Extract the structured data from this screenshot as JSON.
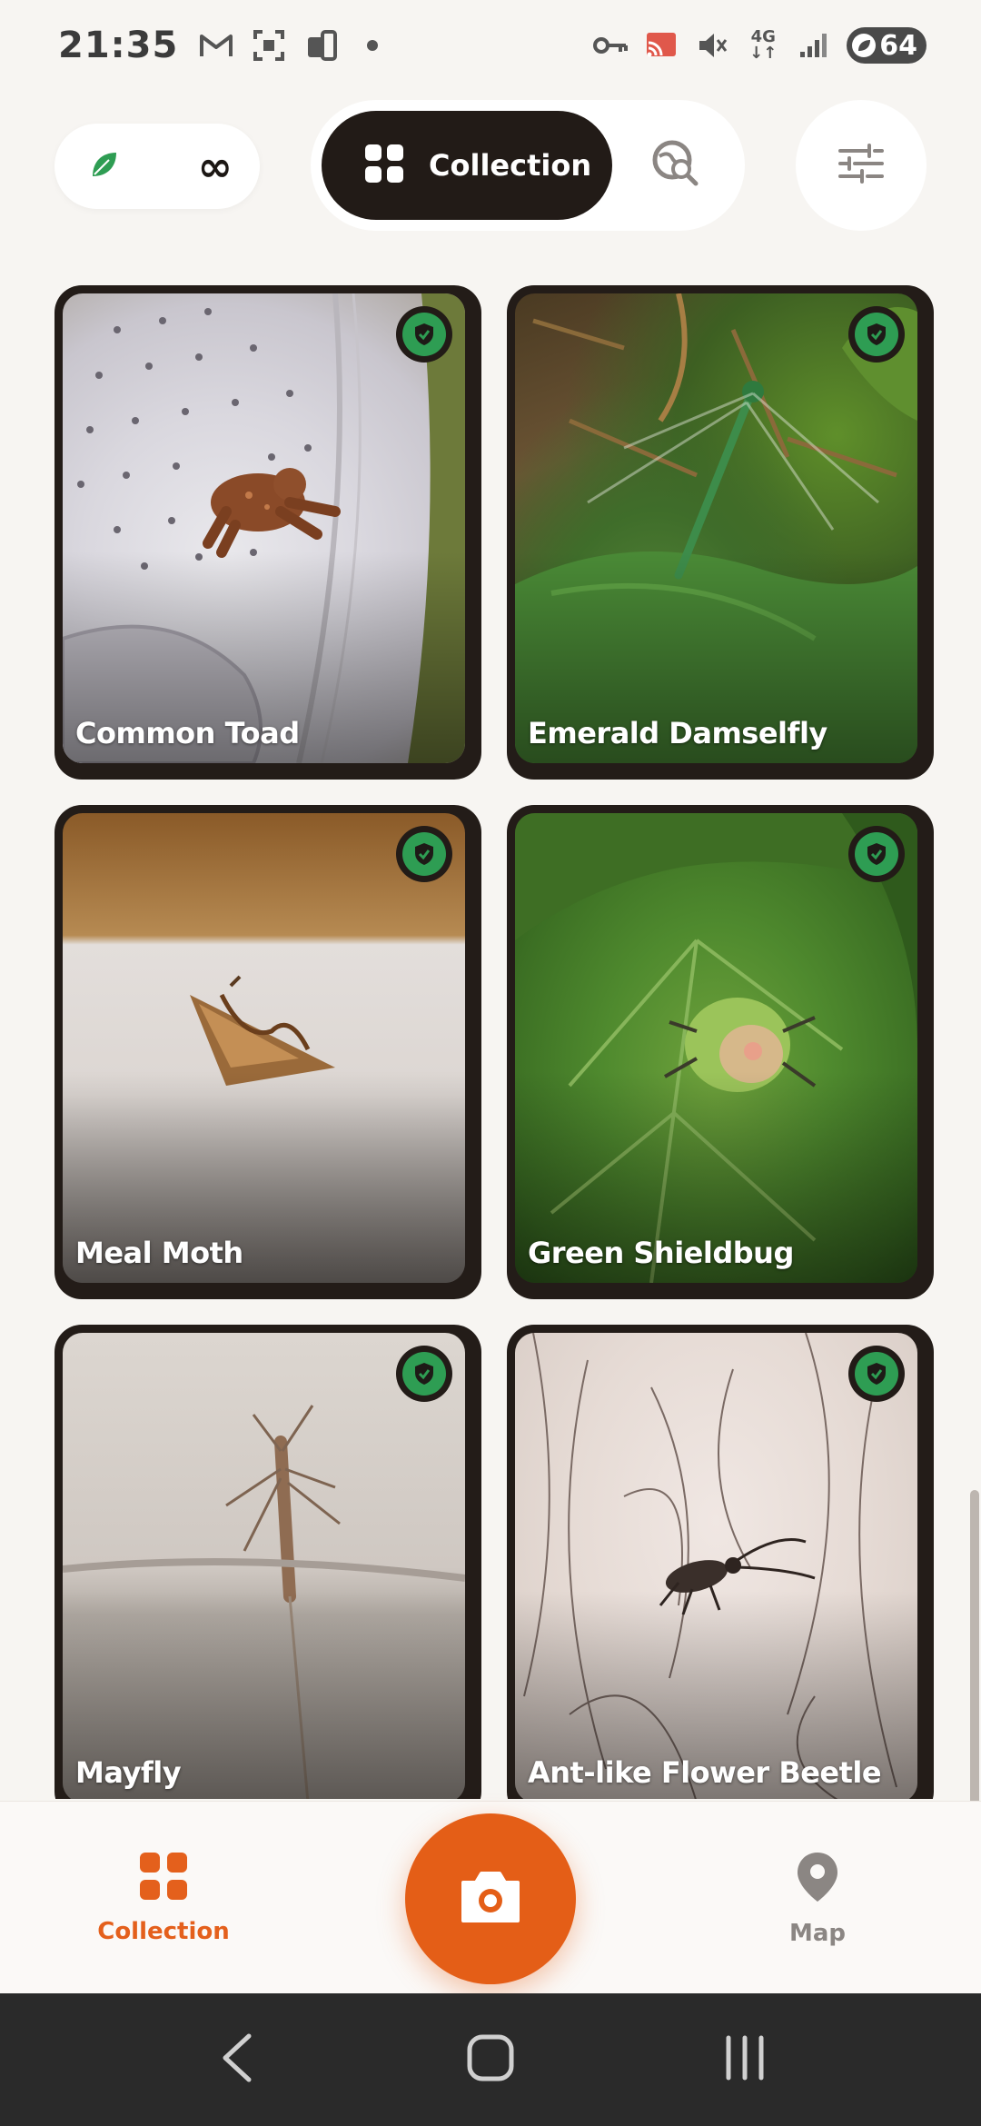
{
  "status_bar": {
    "time": "21:35",
    "network": [
      "4G",
      "↓↑"
    ],
    "battery": "64"
  },
  "top_bar": {
    "streak_value": "∞",
    "view_tabs": [
      {
        "label": "Collection",
        "active": true
      },
      {
        "label": "",
        "icon": "map-search-icon",
        "active": false
      }
    ],
    "filter_icon": "sliders-icon"
  },
  "collection": {
    "items": [
      {
        "name": "Common Toad",
        "verified": true
      },
      {
        "name": "Emerald Damselfly",
        "verified": true
      },
      {
        "name": "Meal Moth",
        "verified": true
      },
      {
        "name": "Green Shieldbug",
        "verified": true
      },
      {
        "name": "Mayfly",
        "verified": true
      },
      {
        "name": "Ant-like Flower Beetle",
        "verified": true
      }
    ]
  },
  "bottom_nav": {
    "collection_label": "Collection",
    "map_label": "Map",
    "camera_icon": "camera-icon"
  },
  "colors": {
    "accent": "#e45e17",
    "dark": "#221b17",
    "verified_green": "#2e9d53",
    "background": "#f7f5f2"
  }
}
